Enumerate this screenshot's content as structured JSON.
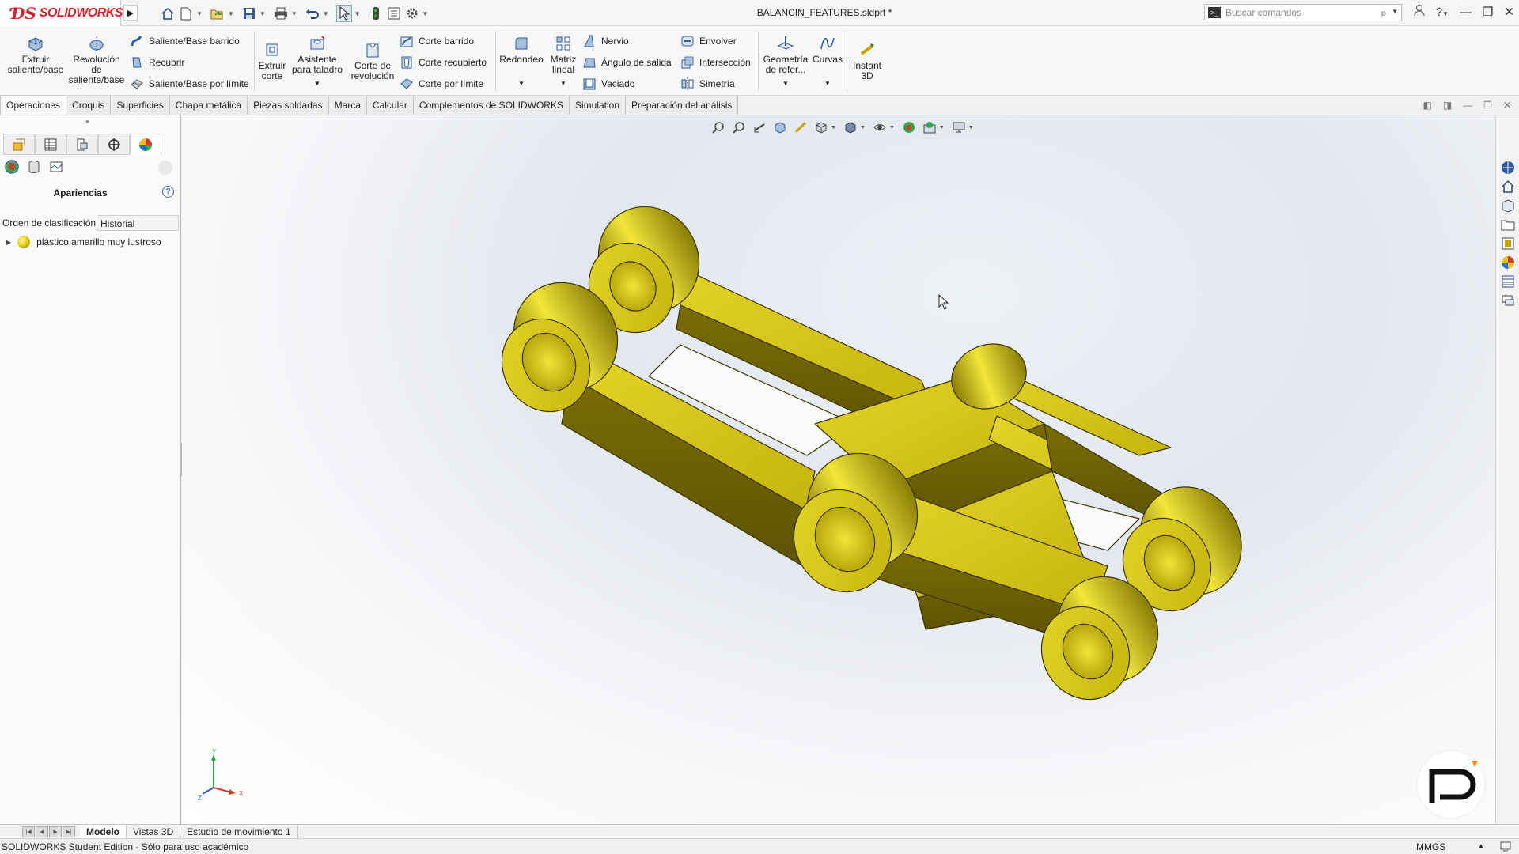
{
  "app": {
    "brand": "SOLIDWORKS",
    "doc_title": "BALANCIN_FEATURES.sldprt *"
  },
  "search": {
    "placeholder": "Buscar comandos"
  },
  "ribbon": {
    "extrude": "Extruir\nsaliente/base",
    "revolve": "Revolución\nde\nsaliente/base",
    "swept_boss": "Saliente/Base barrido",
    "loft": "Recubrir",
    "boundary_boss": "Saliente/Base por límite",
    "extrude_cut": "Extruir\ncorte",
    "hole_wizard": "Asistente\npara taladro",
    "revolve_cut": "Corte de\nrevolución",
    "swept_cut": "Corte barrido",
    "lofted_cut": "Corte recubierto",
    "boundary_cut": "Corte por límite",
    "fillet": "Redondeo",
    "linear_pattern": "Matriz\nlineal",
    "rib": "Nervio",
    "draft": "Ángulo de salida",
    "shell": "Vaciado",
    "wrap": "Envolver",
    "intersect": "Intersección",
    "mirror": "Simetría",
    "ref_geometry": "Geometría\nde refer...",
    "curves": "Curvas",
    "instant3d": "Instant\n3D"
  },
  "tabs": [
    "Operaciones",
    "Croquis",
    "Superficies",
    "Chapa metálica",
    "Piezas soldadas",
    "Marca",
    "Calcular",
    "Complementos de SOLIDWORKS",
    "Simulation",
    "Preparación del análisis"
  ],
  "panel": {
    "title": "Apariencias",
    "help": "?",
    "sort_label": "Orden de clasificación:",
    "sort_value": "Historial",
    "item": "plástico amarillo muy lustroso"
  },
  "bottom_tabs": [
    "Modelo",
    "Vistas 3D",
    "Estudio de movimiento 1"
  ],
  "status": {
    "text": "SOLIDWORKS Student Edition - Sólo para uso académico",
    "units": "MMGS"
  },
  "colors": {
    "brand_red": "#d2232a",
    "part_yellow": "#d4c418",
    "accent_blue": "#2c5a9a"
  }
}
